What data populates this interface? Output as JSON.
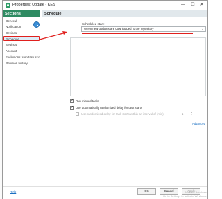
{
  "window": {
    "title": "Properties: Update - KES",
    "minimize": "—",
    "maximize": "☐",
    "close": "✕"
  },
  "sections": {
    "header": "Sections",
    "items": [
      {
        "label": "General"
      },
      {
        "label": "Notification"
      },
      {
        "label": "Devices"
      },
      {
        "label": "Schedule",
        "selected": true
      },
      {
        "label": "Settings"
      },
      {
        "label": "Account"
      },
      {
        "label": "Exclusions from task scope"
      },
      {
        "label": "Revision history"
      }
    ]
  },
  "content": {
    "header": "Schedule",
    "scheduled_start_label": "Scheduled start:",
    "scheduled_start_value": "When new updates are downloaded to the repository",
    "run_missed_label": "Run missed tasks",
    "randomized_delay_label": "Use automatically randomized delay for task starts",
    "randomized_interval_label": "Use randomized delay for task starts within an interval of (min):",
    "interval_value": "1",
    "advanced_link": "Advanced"
  },
  "footer": {
    "help": "Help",
    "ok": "OK",
    "cancel": "Cancel",
    "apply": "Apply"
  },
  "watermark": {
    "line1": "Activate Windows",
    "line2": "Go to Settings to activate Windows."
  },
  "colors": {
    "sections_header": "#2e8b62",
    "annotation": "#e0201e",
    "link": "#1a6fc2"
  }
}
